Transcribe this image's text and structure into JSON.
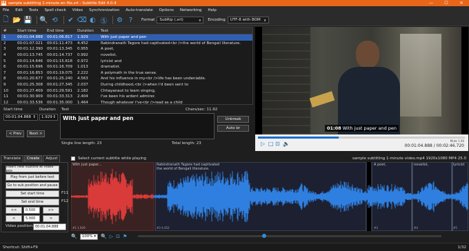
{
  "window": {
    "title": "sample subtitling 1-minute en file.srt - Subtitle Edit 4.0.4",
    "app_icon": "SE",
    "controls": [
      "—",
      "☐",
      "✕"
    ]
  },
  "menu": [
    "File",
    "Edit",
    "Tools",
    "Spell check",
    "Video",
    "Synchronization",
    "Auto-translate",
    "Options",
    "Networking",
    "Help"
  ],
  "toolbar": {
    "format_label": "Format",
    "format_value": "SubRip (.srt)",
    "encoding_label": "Encoding",
    "encoding_value": "UTF-8 with BOM"
  },
  "grid": {
    "headers": [
      "#",
      "Start time",
      "End time",
      "Duration",
      "Text"
    ],
    "rows": [
      {
        "num": "1",
        "start": "00:01:04.888",
        "end": "00:01:06.817",
        "dur": "1.929",
        "text": "With just paper and pen"
      },
      {
        "num": "2",
        "start": "00:01:07.021",
        "end": "00:01:11.473",
        "dur": "4.452",
        "text": "Rabindranath Tagore had captivated<br />the world of Bengali literature."
      },
      {
        "num": "3",
        "start": "00:01:12.390",
        "end": "00:01:13.345",
        "dur": "0.955",
        "text": "A poet,"
      },
      {
        "num": "4",
        "start": "00:01:13.745",
        "end": "00:01:14.737",
        "dur": "0.992",
        "text": "novelist,"
      },
      {
        "num": "5",
        "start": "00:01:14.646",
        "end": "00:01:15.618",
        "dur": "0.972",
        "text": "lyricist and"
      },
      {
        "num": "6",
        "start": "00:01:15.696",
        "end": "00:01:16.709",
        "dur": "1.013",
        "text": "dramatist."
      },
      {
        "num": "7",
        "start": "00:01:16.853",
        "end": "00:01:19.075",
        "dur": "2.222",
        "text": "A polymath in the true sense."
      },
      {
        "num": "8",
        "start": "00:01:20.677",
        "end": "00:01:25.240",
        "dur": "4.563",
        "text": "And his influence in my<br />life has been undeniable."
      },
      {
        "num": "9",
        "start": "00:01:25.308",
        "end": "00:01:27.345",
        "dur": "2.037",
        "text": "During childhood,<br />when I'd been sent to"
      },
      {
        "num": "10",
        "start": "00:01:27.409",
        "end": "00:01:29.591",
        "dur": "2.182",
        "text": "Chhayanaut to learn singing,"
      },
      {
        "num": "11",
        "start": "00:01:30.909",
        "end": "00:01:33.313",
        "dur": "2.404",
        "text": "I've been his ardent admirer."
      },
      {
        "num": "12",
        "start": "00:01:33.536",
        "end": "00:01:35.000",
        "dur": "1.464",
        "text": "Though whatever I've<br />read as a child"
      }
    ]
  },
  "edit": {
    "start_label": "Start time",
    "duration_label": "Duration",
    "text_label": "Text",
    "start_value": "00:01:04.888",
    "duration_value": "1.929",
    "text_value": "With just paper and pen",
    "chars_sec": "Chars/sec: 11.92",
    "single_line_length": "Single line length: 23",
    "total_length": "Total length: 23",
    "prev_label": "< Prev",
    "next_label": "Next >",
    "unbreak_label": "Unbreak",
    "autobr_label": "Auto br"
  },
  "video": {
    "sub_timecode": "01:08",
    "sub_text": "With just paper and pen",
    "volume_label": "Mute 1.00",
    "time": "00:01:04.888 / 00:02:46.720",
    "progress_fraction": 0.39
  },
  "lower": {
    "tabs": [
      "Translate",
      "Create",
      "Adjust"
    ],
    "insert_label": "Insert new subtitle at video pos",
    "play_before_label": "Play from just before text",
    "goto_label": "Go to sub position and pause",
    "set_start_label": "Set start time",
    "set_end_label": "Set end time",
    "f11": "F11",
    "f12": "F12",
    "step_back_1": "<<",
    "step_back_2": "<",
    "step_fwd_1": ">>",
    "step_fwd_2": ">",
    "step_value_1": "0.500",
    "step_value_2": "5.000",
    "video_position_label": "Video position:",
    "video_position_value": "00:01:04.888"
  },
  "waveform": {
    "checkbox_label": "Select current subtitle while playing",
    "file_info": "sample subtitling 1-minute video.mp4 1920x1080 MP4 25.0",
    "segments": [
      {
        "label": "With just paper...",
        "footer": "#1  1.929"
      },
      {
        "label": "Rabindranath Tagore had captivated\nthe world of Bengali literature.",
        "footer": "#2  4.452"
      },
      {
        "label": "A poet,",
        "footer": "#3"
      },
      {
        "label": "novelist,",
        "footer": "#4"
      },
      {
        "label": "lyricist",
        "footer": "#5"
      }
    ],
    "zoom_value": "100%"
  },
  "status": {
    "left": "Shortcut: Shift+F9",
    "right": "1/32"
  },
  "colors": {
    "accent": "#e8661a",
    "selected_row": "#2f5fb3",
    "wave_selected": "#d93a3a",
    "wave_normal": "#2f7fe0"
  }
}
